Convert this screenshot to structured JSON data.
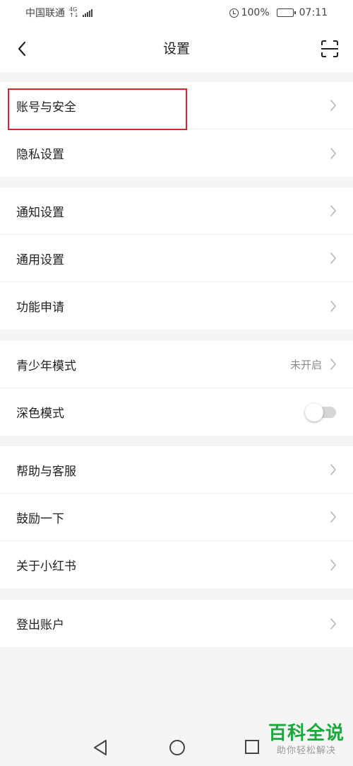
{
  "status_bar": {
    "carrier": "中国联通",
    "net_top": "4G",
    "net_bottom": "↑↓",
    "battery": "100%",
    "time": "07:11"
  },
  "header": {
    "title": "设置"
  },
  "groups": [
    {
      "items": [
        {
          "label": "账号与安全"
        },
        {
          "label": "隐私设置"
        }
      ]
    },
    {
      "items": [
        {
          "label": "通知设置"
        },
        {
          "label": "通用设置"
        },
        {
          "label": "功能申请"
        }
      ]
    },
    {
      "items": [
        {
          "label": "青少年模式",
          "value": "未开启"
        },
        {
          "label": "深色模式",
          "toggle": false
        }
      ]
    },
    {
      "items": [
        {
          "label": "帮助与客服"
        },
        {
          "label": "鼓励一下"
        },
        {
          "label": "关于小红书"
        }
      ]
    },
    {
      "items": [
        {
          "label": "登出账户"
        }
      ]
    }
  ],
  "watermark": {
    "main": "百科全说",
    "sub": "助你轻松解决"
  },
  "icons": {
    "back": "chevron-left-icon",
    "scan": "scan-icon",
    "row_arrow": "chevron-right-icon",
    "nav_back": "triangle-back-icon",
    "nav_home": "circle-home-icon",
    "nav_recent": "square-recent-icon"
  },
  "colors": {
    "highlight": "#cc2b2b",
    "watermark": "#19a83a",
    "background": "#f5f5f5"
  }
}
